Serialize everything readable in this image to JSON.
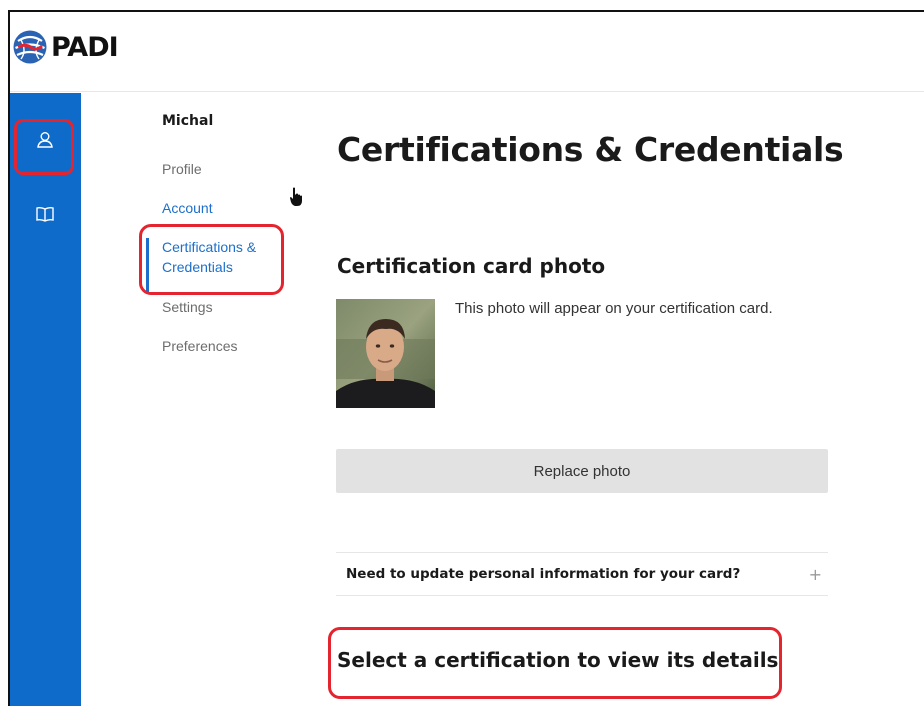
{
  "brand": {
    "logo_text": "PADI",
    "accent_color": "#0f6bc9",
    "highlight_color": "#e4252f"
  },
  "rail": {
    "items": [
      {
        "icon": "user-icon"
      },
      {
        "icon": "book-icon"
      }
    ]
  },
  "subnav": {
    "user_name": "Michal",
    "items": [
      {
        "label": "Profile"
      },
      {
        "label": "Account"
      },
      {
        "label": "Certifications &\nCredentials"
      },
      {
        "label": "Settings"
      },
      {
        "label": "Preferences"
      }
    ]
  },
  "main": {
    "page_title": "Certifications & Credentials",
    "photo_section": {
      "heading": "Certification card photo",
      "description": "This photo will appear on your certification card.",
      "replace_label": "Replace photo"
    },
    "accordion": {
      "question": "Need to update personal information for your card?",
      "toggle": "+"
    },
    "select_heading": "Select a certification to view its details"
  }
}
